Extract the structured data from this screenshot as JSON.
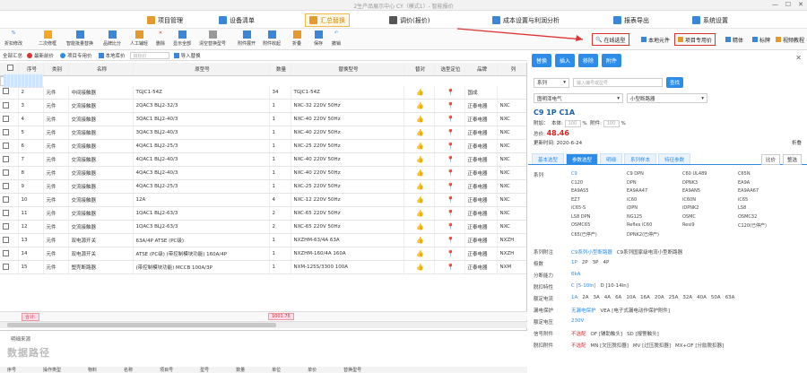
{
  "window": {
    "title": "2生产品展示中心 CY（模式1）- 智能报价"
  },
  "menus": [
    {
      "label": "项目管理",
      "color": "#e49a2c"
    },
    {
      "label": "设备清单",
      "color": "#3a86d9"
    },
    {
      "label": "汇总替换",
      "color": "#e49a2c"
    },
    {
      "label": "调价(报价)",
      "color": "#555555"
    },
    {
      "label": "成本设置与利润分析",
      "color": "#3a86d9"
    },
    {
      "label": "报表导出",
      "color": "#3a86d9"
    },
    {
      "label": "系统设置",
      "color": "#3a86d9"
    }
  ],
  "toolbar": [
    "折扣修改",
    "二次修框",
    "智能批量替换",
    "品牌比分",
    "人工辅轻",
    "删除",
    "显示全部",
    "清空替换型号",
    "附件展开",
    "附件收起",
    "折叠",
    "保存",
    "撤销"
  ],
  "right_buttons": {
    "online_select": "在线选型",
    "local_lib": "本地元件",
    "project_price": "项目专用价",
    "label_a": "精体",
    "label_b": "标牌",
    "label_c": "视频教程"
  },
  "subbar": {
    "all": "全部汇总",
    "project_price": "最新前价",
    "project_special": "项目专用价",
    "local_alt": "本地库价",
    "blank": "",
    "recent_price": "目标价",
    "import": "导入替换"
  },
  "table": {
    "headers": [
      "",
      "序号",
      "类别",
      "名称",
      "原型号",
      "数量",
      "替换型号",
      "替对",
      "选型定位",
      "品牌",
      "列"
    ],
    "rows": [
      [
        "",
        "1",
        "元件",
        "EPS应急电源",
        "应急照明集中电源",
        "15",
        "",
        "",
        "",
        "",
        ""
      ],
      [
        "",
        "2",
        "元件",
        "中间接触器",
        "TGJC1-54Z",
        "34",
        "TGJC1-54Z",
        "",
        "",
        "国成",
        ""
      ],
      [
        "",
        "3",
        "元件",
        "交流接触器",
        "2QAC3 BLJ2-32/3",
        "1",
        "NXC-32 220V 50Hz",
        "",
        "",
        "正泰电器",
        "NXC"
      ],
      [
        "",
        "4",
        "元件",
        "交流接触器",
        "3QAC1 BLJ2-40/3",
        "1",
        "NXC-40 220V 50Hz",
        "",
        "",
        "正泰电器",
        "NXC"
      ],
      [
        "",
        "5",
        "元件",
        "交流接触器",
        "3QAC3 BLJ2-40/3",
        "1",
        "NXC-40 220V 50Hz",
        "",
        "",
        "正泰电器",
        "NXC"
      ],
      [
        "",
        "6",
        "元件",
        "交流接触器",
        "4QAC1 BLJ2-25/3",
        "1",
        "NXC-25 220V 50Hz",
        "",
        "",
        "正泰电器",
        "NXC"
      ],
      [
        "",
        "7",
        "元件",
        "交流接触器",
        "4QAC1 BLJ2-40/3",
        "1",
        "NXC-40 220V 50Hz",
        "",
        "",
        "正泰电器",
        "NXC"
      ],
      [
        "",
        "8",
        "元件",
        "交流接触器",
        "4QAC3 BLJ2-40/3",
        "1",
        "NXC-40 220V 50Hz",
        "",
        "",
        "正泰电器",
        "NXC"
      ],
      [
        "",
        "9",
        "元件",
        "交流接触器",
        "4QAC3 BLJ2-25/3",
        "1",
        "NXC-25 220V 50Hz",
        "",
        "",
        "正泰电器",
        "NXC"
      ],
      [
        "",
        "10",
        "元件",
        "交流接触器",
        "12A",
        "4",
        "NXC-12 220V 50Hz",
        "",
        "",
        "正泰电器",
        "NXC"
      ],
      [
        "",
        "11",
        "元件",
        "交流接触器",
        "1QAC1 BLJ2-63/3",
        "2",
        "NXC-65 220V 50Hz",
        "",
        "",
        "正泰电器",
        "NXC"
      ],
      [
        "",
        "12",
        "元件",
        "交流接触器",
        "1QAC3 BLJ2-63/3",
        "2",
        "NXC-65 220V 50Hz",
        "",
        "",
        "正泰电器",
        "NXC"
      ],
      [
        "",
        "13",
        "元件",
        "双电源开关",
        "63A/4P ATSE (PC级)",
        "1",
        "NXZHM-63/4A 63A",
        "",
        "",
        "正泰电器",
        "NXZH"
      ],
      [
        "",
        "14",
        "元件",
        "双电源开关",
        "ATSE (PC级) (带控制模块功能) 160A/4P",
        "1",
        "NXZHM-160/4A 160A",
        "",
        "",
        "正泰电器",
        "NXZH"
      ],
      [
        "",
        "15",
        "元件",
        "塑壳断路器",
        "(带控制模块功能) MCCB 100A/3P",
        "1",
        "NXM-125S/3300 100A",
        "",
        "",
        "正泰电器",
        "NXM"
      ]
    ],
    "sum_left": "合计:",
    "sum_mid": "1001.76"
  },
  "bottom": {
    "label": "明细来源",
    "cols": [
      "序号",
      "操作类型",
      "物料",
      "名称",
      "项目号",
      "型号",
      "数量",
      "单位",
      "单价",
      "替换型号"
    ],
    "watermark": "数据路径"
  },
  "right_panel": {
    "tabs": [
      "替换",
      "插入",
      "移除",
      "附件"
    ],
    "series_label": "系列",
    "search_placeholder": "输入编号或型号",
    "search_btn": "查找",
    "brand": "图明漆电气",
    "category": "小型断路器",
    "model": "C9 1P C1A",
    "labels": {
      "cost": "附加：",
      "body": "本体:",
      "qty": "100",
      "pct": "%",
      "attach": "附件:",
      "total": "总价:",
      "update": "更新时间:",
      "bottom_right": "折叠"
    },
    "price": "48.46",
    "date": "2020-6-24",
    "detail_tabs": [
      "基本选型",
      "参数选型",
      "明细",
      "系列样本",
      "特征参数"
    ],
    "compare": "比价",
    "pick": "整选",
    "series_title": "系列",
    "series_items": [
      "C9",
      "C9 DPN",
      "C60 UL489",
      "C65N",
      "C120",
      "DPN",
      "DPNK3",
      "EA9A",
      "EA9AS5",
      "EA9AA47",
      "EA9AN5",
      "EA9AA67",
      "EZ7",
      "iC60",
      "iC60N",
      "iC65",
      "iC65-S",
      "iDPN",
      "iDPNK2",
      "LS8",
      "LS8 DPN",
      "NG125",
      "OSMC",
      "OSMC32",
      "OSMC65",
      "Reflex iC60",
      "Resi9",
      "C120(已停产)",
      "C65(已停产)",
      "DPNK2(已停产)"
    ],
    "attrs": [
      {
        "k": "系列附注",
        "v": [
          "C9系列小型断路器",
          "C9系列国家级电流小型断路器"
        ]
      },
      {
        "k": "极数",
        "v": [
          "1P",
          "2P",
          "3P",
          "4P"
        ]
      },
      {
        "k": "分断能力",
        "v": [
          "6kA"
        ]
      },
      {
        "k": "脱扣特性",
        "v": [
          "C [5-10In]",
          "D [10-14In]"
        ]
      },
      {
        "k": "额定电流",
        "v": [
          "1A",
          "2A",
          "3A",
          "4A",
          "6A",
          "10A",
          "16A",
          "20A",
          "25A",
          "32A",
          "40A",
          "50A",
          "63A"
        ]
      },
      {
        "k": "漏电保护",
        "v": [
          "无漏电保护",
          "VEA [电子式漏电动作保护附件]"
        ]
      },
      {
        "k": "额定电压",
        "v": [
          "230V"
        ]
      },
      {
        "k": "信号附件",
        "v": [
          "不选配",
          "OF [辅助触头]",
          "SD [报警触头]"
        ]
      },
      {
        "k": "脱扣附件",
        "v": [
          "不选配",
          "MN [欠压脱扣器]",
          "MV [过压脱扣器]",
          "MX+OF [分励脱扣器]"
        ]
      }
    ]
  }
}
